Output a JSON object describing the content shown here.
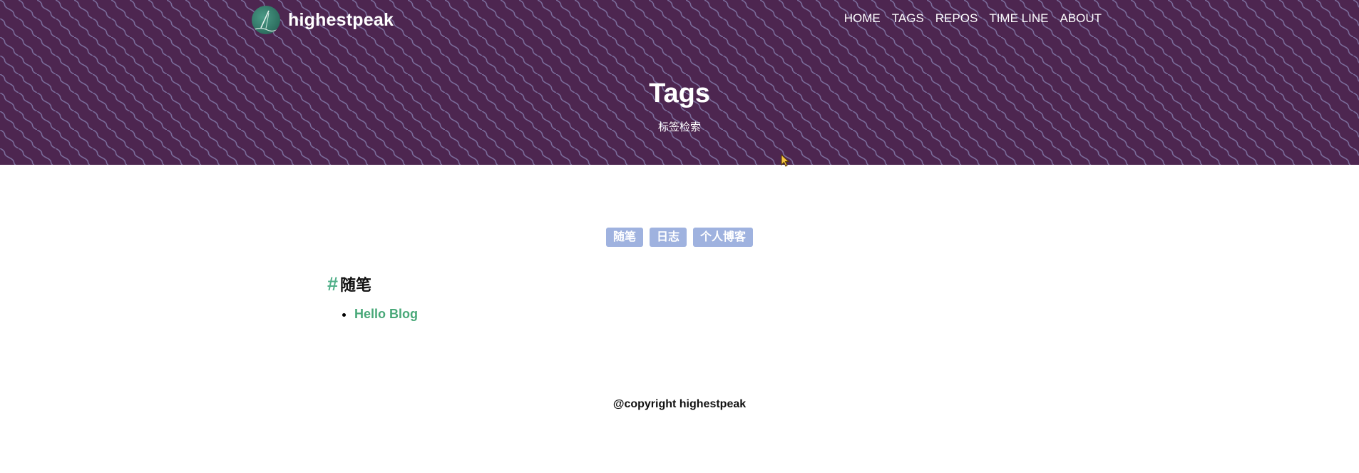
{
  "header": {
    "brand": "highestpeak",
    "nav": [
      "HOME",
      "TAGS",
      "REPOS",
      "TIME LINE",
      "ABOUT"
    ]
  },
  "hero": {
    "title": "Tags",
    "subtitle": "标签检索"
  },
  "tags": [
    "随笔",
    "日志",
    "个人博客"
  ],
  "section": {
    "hash": "#",
    "title": "随笔",
    "posts": [
      "Hello Blog"
    ]
  },
  "footer": {
    "text": "@copyright highestpeak"
  },
  "colors": {
    "hero_bg": "#4d2650",
    "tag_bg": "#9fb2df",
    "accent": "#52b08a",
    "link": "#48a878"
  },
  "icons": {
    "avatar": "avatar-image",
    "cursor": "mouse-cursor-icon"
  }
}
